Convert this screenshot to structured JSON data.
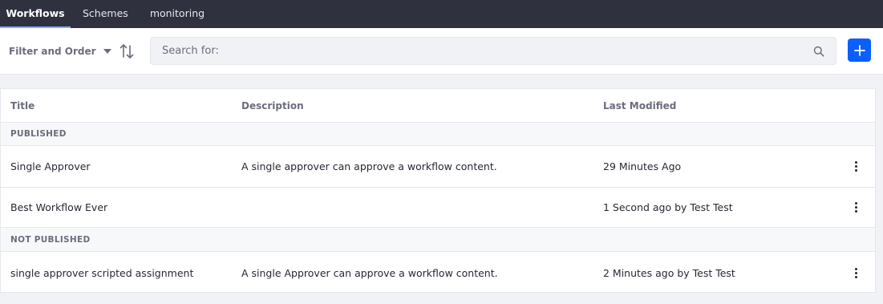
{
  "nav": {
    "tabs": [
      {
        "label": "Workflows",
        "active": true
      },
      {
        "label": "Schemes",
        "active": false
      },
      {
        "label": "monitoring",
        "active": false
      }
    ]
  },
  "toolbar": {
    "filter_label": "Filter and Order",
    "search_placeholder": "Search for:",
    "search_value": "",
    "accent_color": "#0b5fff"
  },
  "table": {
    "columns": [
      "Title",
      "Description",
      "Last Modified"
    ],
    "groups": [
      {
        "label": "PUBLISHED",
        "rows": [
          {
            "title": "Single Approver",
            "description": "A single approver can approve a workflow content.",
            "modified": "29 Minutes Ago"
          },
          {
            "title": "Best Workflow Ever",
            "description": "",
            "modified": "1 Second ago by Test Test"
          }
        ]
      },
      {
        "label": "NOT PUBLISHED",
        "rows": [
          {
            "title": "single approver scripted assignment",
            "description": "A single Approver can approve a workflow content.",
            "modified": "2 Minutes ago by Test Test"
          }
        ]
      }
    ]
  }
}
